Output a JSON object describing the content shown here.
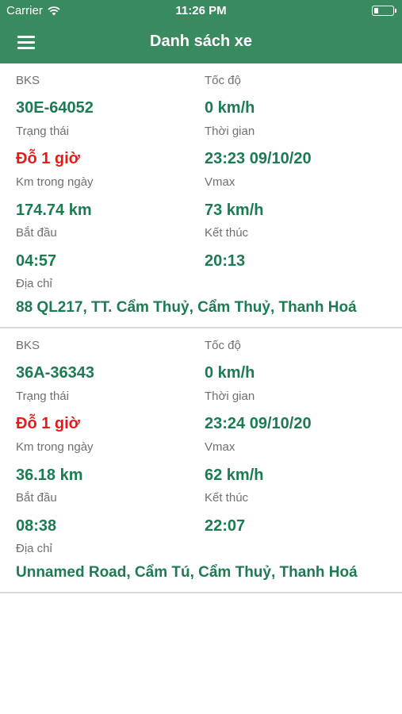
{
  "status_bar": {
    "carrier": "Carrier",
    "time": "11:26 PM"
  },
  "nav": {
    "title": "Danh sách xe",
    "menu_icon": "hamburger-menu-icon"
  },
  "labels": {
    "plate": "BKS",
    "speed": "Tốc độ",
    "status": "Trạng thái",
    "time": "Thời gian",
    "km_today": "Km trong ngày",
    "vmax": "Vmax",
    "start": "Bắt đầu",
    "end": "Kết thúc",
    "address": "Địa chỉ"
  },
  "vehicles": [
    {
      "plate": "30E-64052",
      "speed": "0 km/h",
      "status": "Đỗ 1 giờ",
      "time": "23:23 09/10/20",
      "km_today": "174.74 km",
      "vmax": "73 km/h",
      "start": "04:57",
      "end": "20:13",
      "address": "88 QL217, TT. Cẩm Thuỷ, Cẩm Thuỷ, Thanh Hoá"
    },
    {
      "plate": "36A-36343",
      "speed": "0 km/h",
      "status": "Đỗ 1 giờ",
      "time": "23:24 09/10/20",
      "km_today": "36.18 km",
      "vmax": "62 km/h",
      "start": "08:38",
      "end": "22:07",
      "address": "Unnamed Road, Cẩm Tú, Cẩm Thuỷ, Thanh Hoá"
    }
  ],
  "colors": {
    "header": "#3a8a5f",
    "value": "#1d7b52",
    "alert": "#e31c1c",
    "label": "#6f6f6f"
  }
}
